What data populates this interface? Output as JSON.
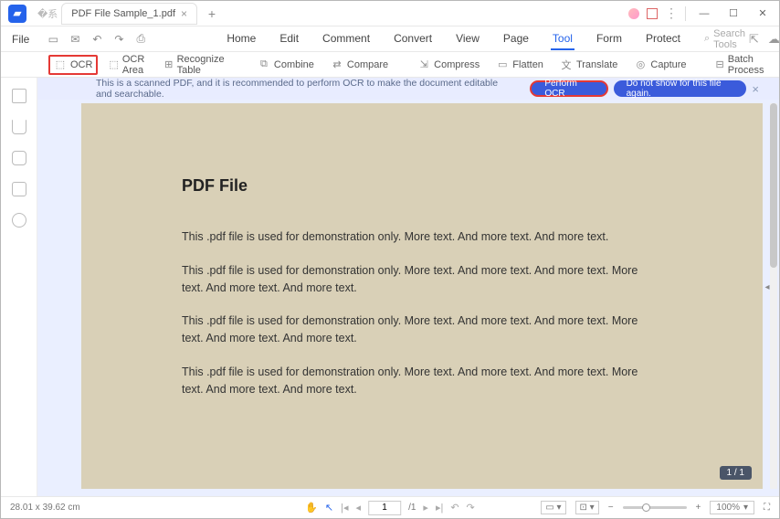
{
  "titlebar": {
    "tab_title": "PDF File Sample_1.pdf"
  },
  "menu": {
    "file": "File",
    "items": [
      "Home",
      "Edit",
      "Comment",
      "Convert",
      "View",
      "Page",
      "Tool",
      "Form",
      "Protect"
    ],
    "active": "Tool",
    "search_placeholder": "Search Tools"
  },
  "toolbar": {
    "ocr": "OCR",
    "ocr_area": "OCR Area",
    "recognize_table": "Recognize Table",
    "combine": "Combine",
    "compare": "Compare",
    "compress": "Compress",
    "flatten": "Flatten",
    "translate": "Translate",
    "capture": "Capture",
    "batch": "Batch Process"
  },
  "banner": {
    "message": "This is a scanned PDF, and it is recommended to perform OCR to make the document editable and searchable.",
    "primary": "Perform OCR",
    "secondary": "Do not show for this file again."
  },
  "ocr_pill": "OCR",
  "doc": {
    "title": "PDF File",
    "p1": "This .pdf file is used for demonstration only. More text. And more text. And more text.",
    "p2": "This .pdf file is used for demonstration only. More text. And more text. And more text. More text. And more text. And more text.",
    "p3": "This .pdf file is used for demonstration only. More text. And more text. And more text. More text. And more text. And more text.",
    "p4": "This .pdf file is used for demonstration only. More text. And more text. And more text. More text. And more text. And more text."
  },
  "page_indicator": "1 / 1",
  "status": {
    "dims": "28.01 x 39.62 cm",
    "page_current": "1",
    "page_total": "/1",
    "zoom": "100%"
  }
}
